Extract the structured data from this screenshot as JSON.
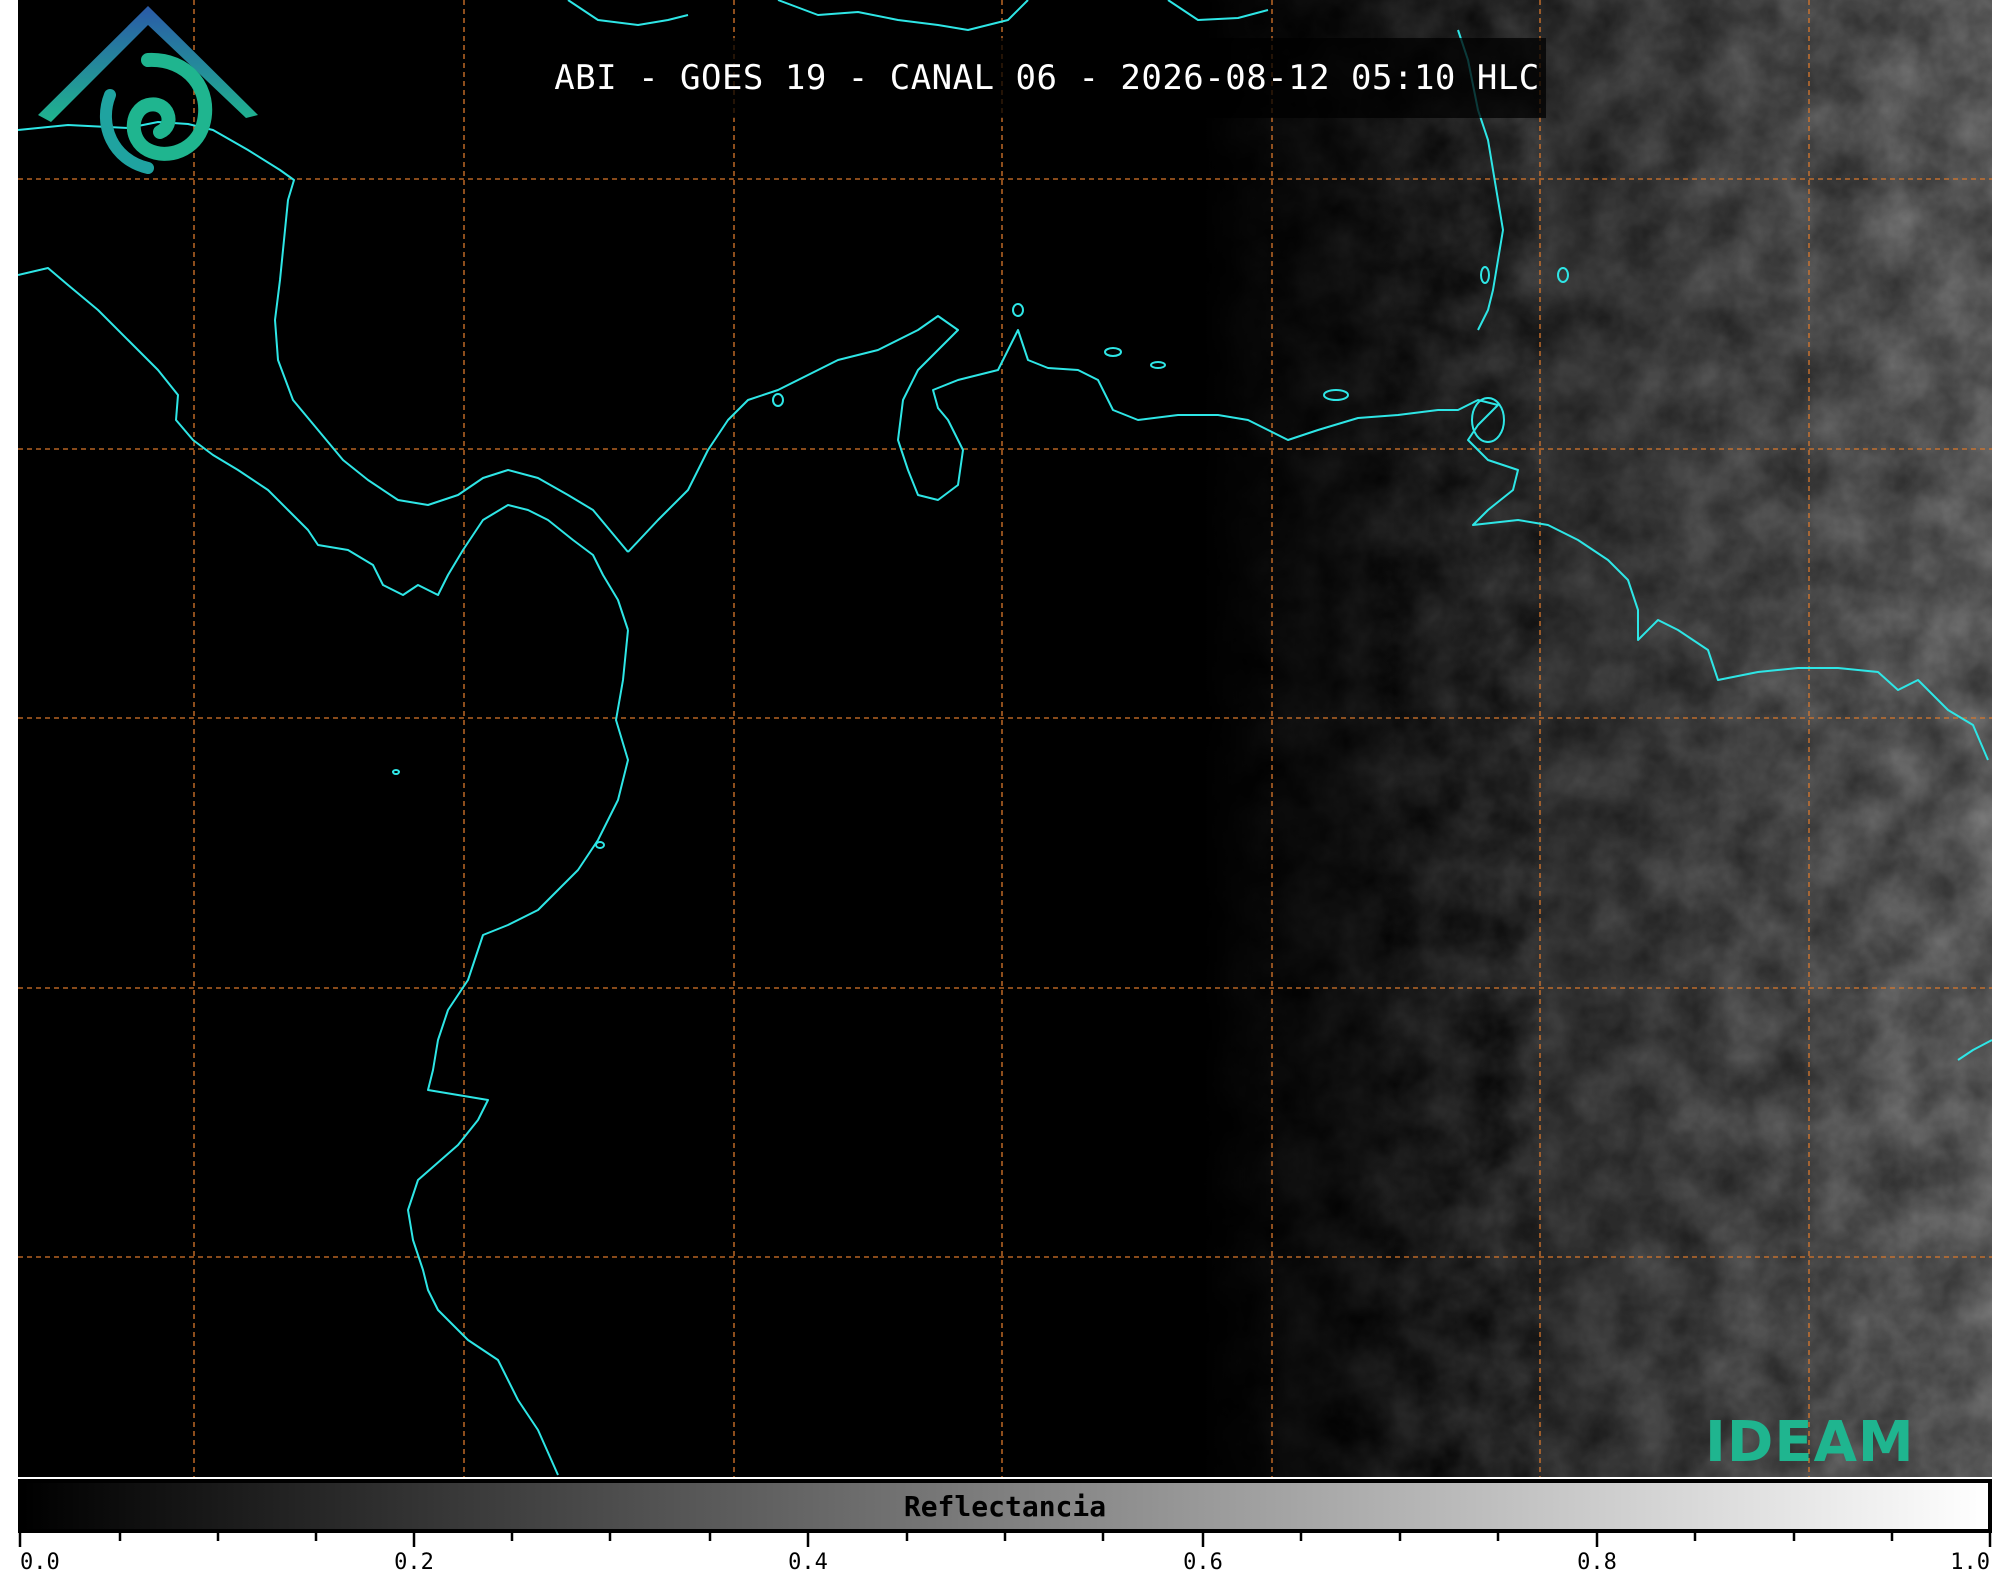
{
  "title": "ABI - GOES 19 - CANAL 06 - 2026-08-12 05:10 HLC",
  "colorbar": {
    "label": "Reflectancia",
    "range": [
      0.0,
      1.0
    ],
    "tick_labels": [
      "0.0",
      "0.2",
      "0.4",
      "0.6",
      "0.8",
      "1.0"
    ],
    "colormap": [
      "#000000",
      "#ffffff"
    ]
  },
  "logo": {
    "text": "IDEAM"
  },
  "colors": {
    "coastline": "#2ee6e6",
    "gridline": "#d9772b",
    "background": "#000000"
  },
  "map": {
    "grid": "dashed",
    "dim_region_side": "east"
  }
}
